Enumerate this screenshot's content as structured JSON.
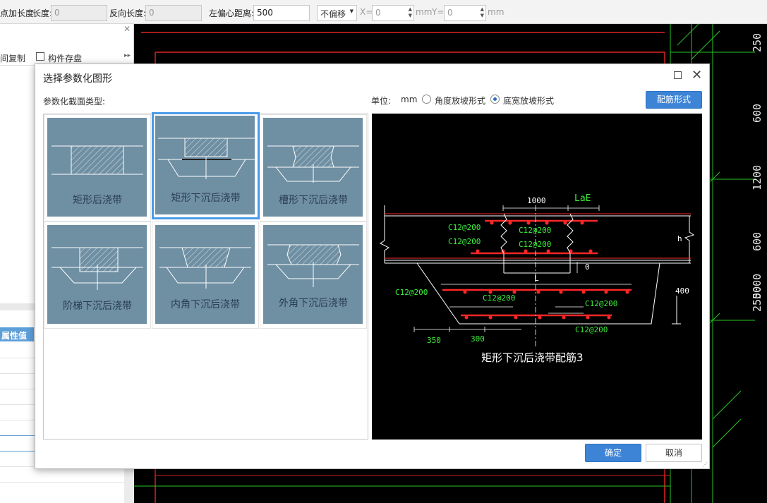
{
  "toolbar": {
    "add_length_label": "点加长度",
    "length_label": "长度:",
    "length_value": "0",
    "reverse_length_label": "反向长度:",
    "reverse_length_value": "0",
    "left_offset_label": "左偏心距离:",
    "left_offset_value": "500",
    "offset_mode": "不偏移",
    "x_label": "X=",
    "x_value": "0",
    "unit1": "mm",
    "y_label": "Y=",
    "y_value": "0",
    "unit2": "mm"
  },
  "left_panel": {
    "copy_label": "间复制",
    "save_label": "构件存盘",
    "props_header": "属性值"
  },
  "cad": {
    "ruler_labels": [
      "250",
      "600",
      "1200",
      "600",
      "5000",
      "2500"
    ]
  },
  "dialog": {
    "title": "选择参数化图形",
    "type_label": "参数化截面类型:",
    "unit_label": "单位:",
    "unit_value": "mm",
    "radio_angle": "角度放坡形式",
    "radio_width": "底宽放坡形式",
    "rebar_button": "配筋形式",
    "ok_button": "确定",
    "cancel_button": "取消",
    "shapes": [
      {
        "label": "矩形后浇带"
      },
      {
        "label": "矩形下沉后浇带"
      },
      {
        "label": "槽形下沉后浇带"
      },
      {
        "label": "阶梯下沉后浇带"
      },
      {
        "label": "内角下沉后浇带"
      },
      {
        "label": "外角下沉后浇带"
      }
    ],
    "preview": {
      "caption": "矩形下沉后浇带配筋3",
      "dim_1000": "1000",
      "lae": "LaE",
      "rebar1": "C12@200",
      "rebar2": "C12@200",
      "rebar3": "C12@200",
      "rebar4": "C12@200",
      "rebar5": "C12@200",
      "rebar6": "C12@200",
      "rebar7": "C12@200",
      "rebar8": "C12@200",
      "h": "h",
      "zero": "0",
      "l": "L",
      "d400": "400",
      "d350": "350",
      "d300": "300"
    }
  }
}
